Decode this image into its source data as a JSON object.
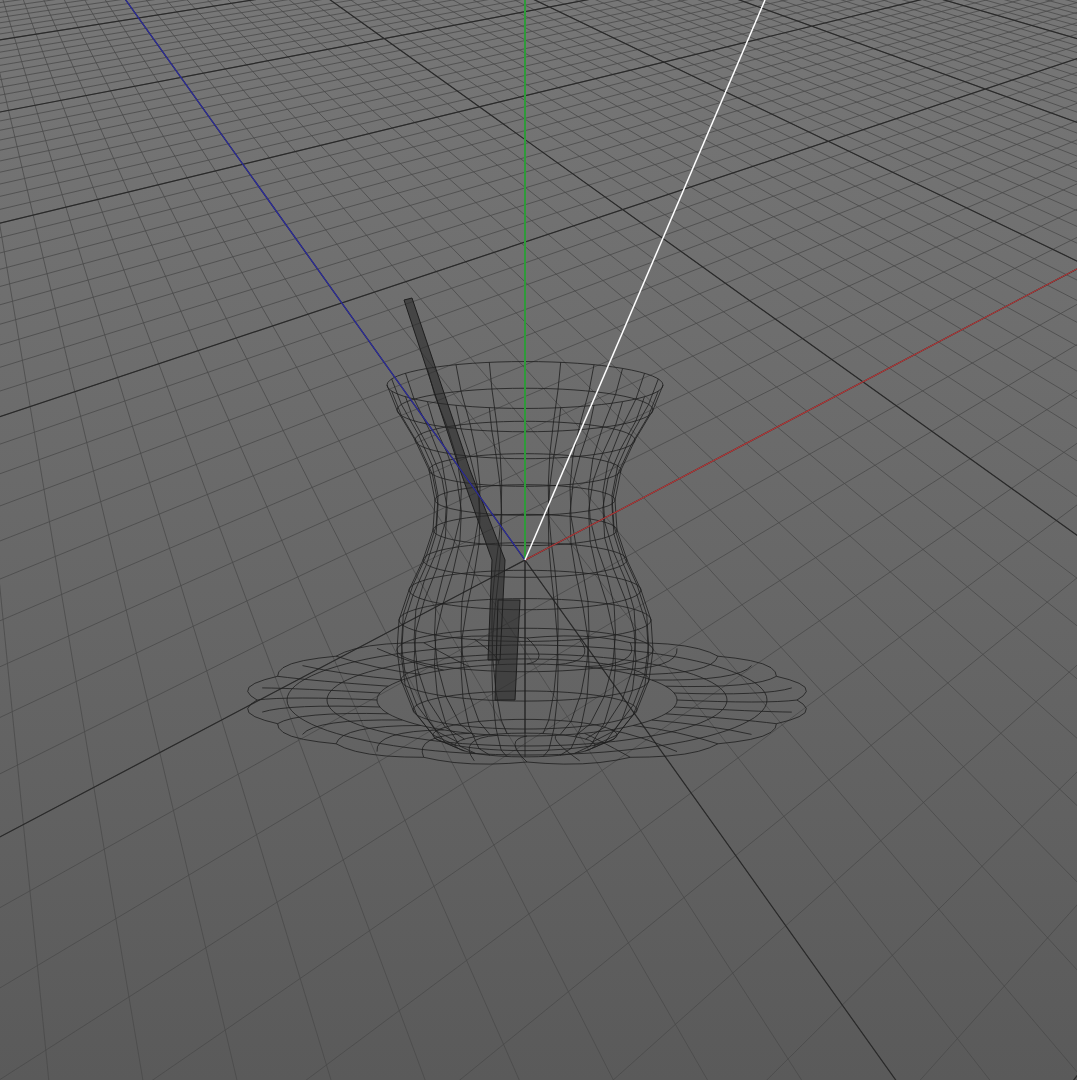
{
  "viewport": {
    "axes": [
      {
        "kind": "x",
        "color": "#b03a3a"
      },
      {
        "kind": "y",
        "color": "#2f9a3a"
      },
      {
        "kind": "z",
        "color": "#2c2c9e"
      }
    ]
  }
}
